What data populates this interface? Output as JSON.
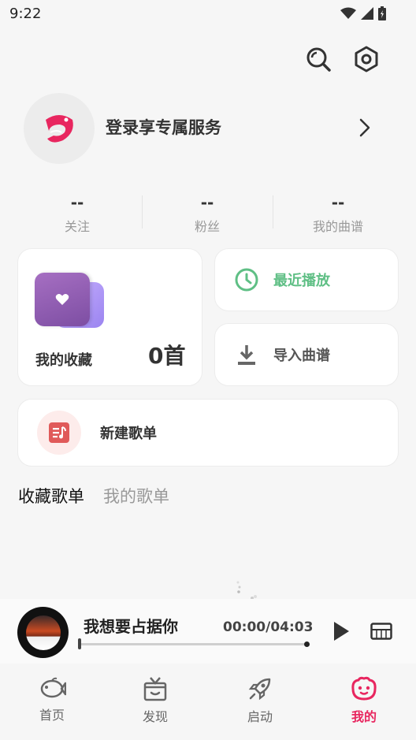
{
  "status_bar": {
    "time": "9:22"
  },
  "header": {
    "search_icon": "search-icon",
    "settings_icon": "settings-hex-icon"
  },
  "login": {
    "text": "登录享专属服务",
    "logo": "app-fish-logo"
  },
  "stats": [
    {
      "value": "--",
      "label": "关注"
    },
    {
      "value": "--",
      "label": "粉丝"
    },
    {
      "value": "--",
      "label": "我的曲谱"
    }
  ],
  "favorites": {
    "label": "我的收藏",
    "count": "0首"
  },
  "recent": {
    "label": "最近播放"
  },
  "import": {
    "label": "导入曲谱"
  },
  "new_playlist": {
    "label": "新建歌单"
  },
  "tabs": [
    {
      "label": "收藏歌单",
      "active": true
    },
    {
      "label": "我的歌单",
      "active": false
    }
  ],
  "player": {
    "title": "我想要占据你",
    "time": "00:00/04:03",
    "progress": 0
  },
  "nav": [
    {
      "label": "首页",
      "icon": "fish-icon"
    },
    {
      "label": "发现",
      "icon": "gift-box-icon"
    },
    {
      "label": "启动",
      "icon": "rocket-icon"
    },
    {
      "label": "我的",
      "icon": "smiley-icon",
      "active": true
    }
  ],
  "colors": {
    "accent": "#e8265f",
    "recent_green": "#5fbf85",
    "new_icon_red": "#e05a5a"
  }
}
